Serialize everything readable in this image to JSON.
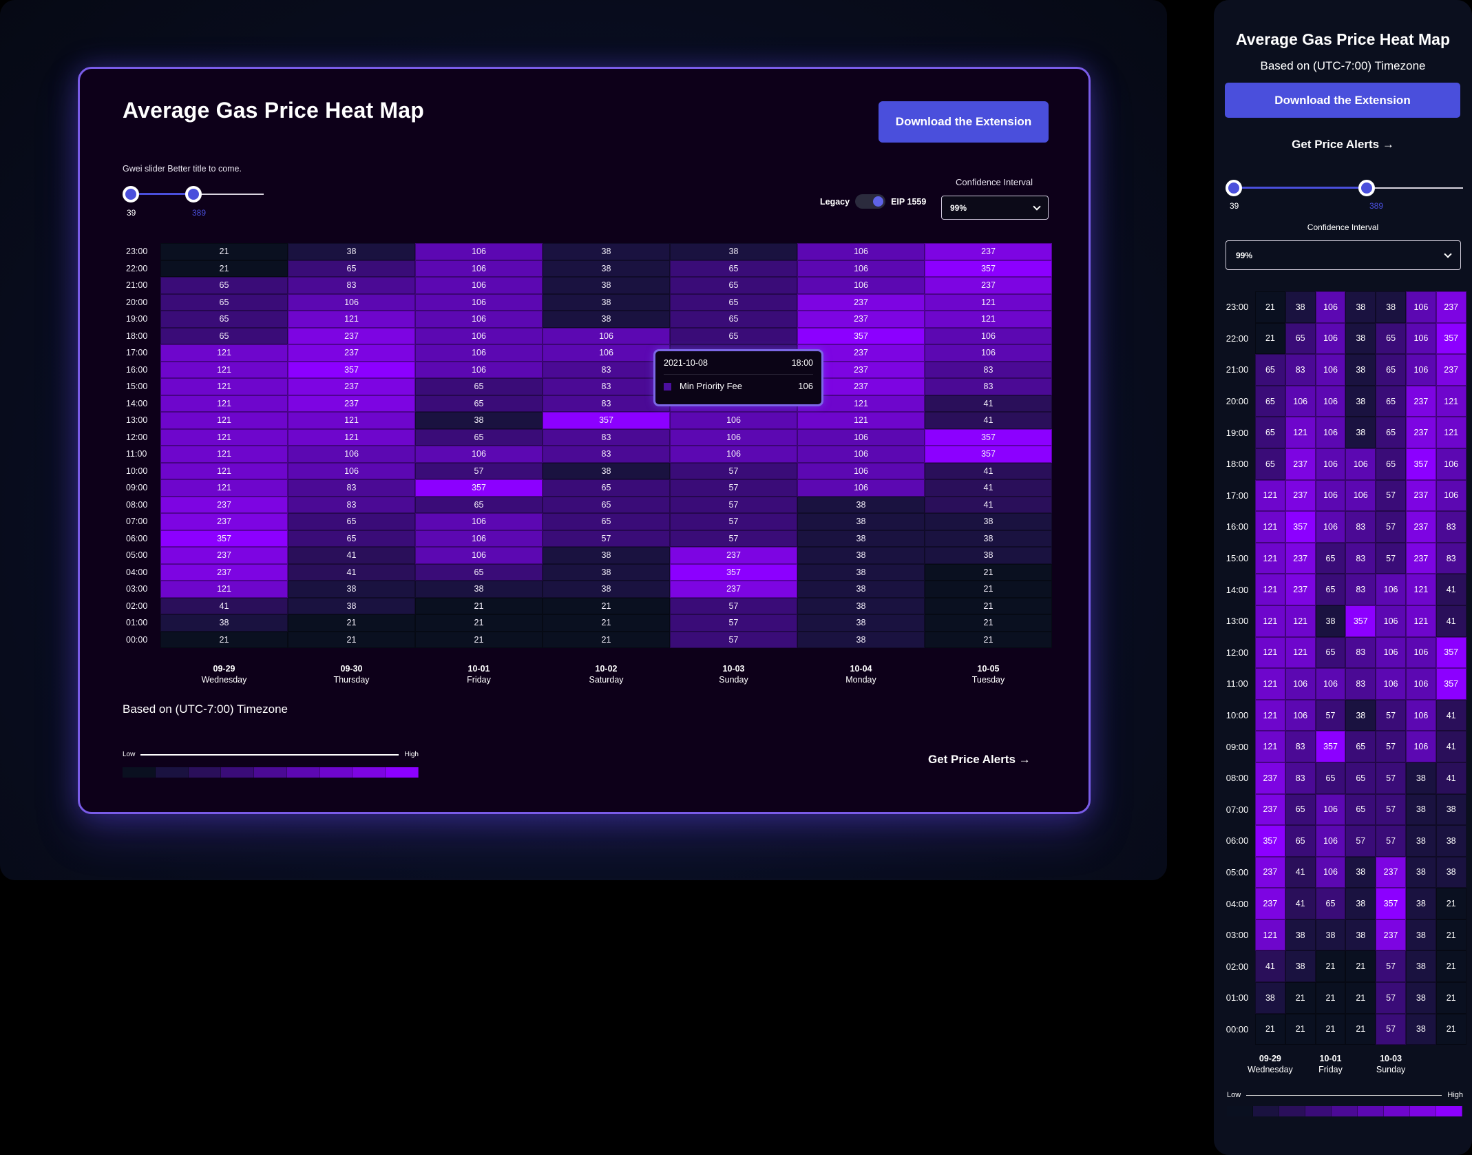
{
  "desktop": {
    "title": "Average Gas Price Heat Map",
    "download_button": "Download the Extension",
    "slider": {
      "label": "Gwei slider Better title to come.",
      "min_value": "39",
      "max_value": "389",
      "low_fraction": 0.0,
      "high_fraction": 0.5
    },
    "toggle": {
      "left_label": "Legacy",
      "right_label": "EIP 1559",
      "state": "EIP 1559"
    },
    "confidence": {
      "label": "Confidence Interval",
      "selected": "99%"
    },
    "timezone_note": "Based on (UTC-7:00) Timezone",
    "legend": {
      "low": "Low",
      "high": "High"
    },
    "alerts_link": "Get Price Alerts",
    "arrow_icon": "→",
    "tooltip": {
      "date": "2021-10-08",
      "time": "18:00",
      "series": "Min Priority Fee",
      "value": "106"
    }
  },
  "mobile": {
    "title": "Average Gas Price Heat Map",
    "timezone_note": "Based on (UTC-7:00) Timezone",
    "download_button": "Download the Extension",
    "alerts_link": "Get Price Alerts",
    "slider": {
      "min_value": "39",
      "max_value": "389",
      "low_fraction": 0.0,
      "high_fraction": 0.6
    },
    "confidence": {
      "label": "Confidence Interval",
      "selected": "99%"
    },
    "x_labels": [
      {
        "date": "09-29",
        "day": "Wednesday",
        "col": 0
      },
      {
        "date": "10-01",
        "day": "Friday",
        "col": 2
      },
      {
        "date": "10-03",
        "day": "Sunday",
        "col": 4
      }
    ],
    "legend": {
      "low": "Low",
      "high": "High"
    }
  },
  "color_scale": [
    "#0a1020",
    "#1a1240",
    "#2a0f5a",
    "#3a0c78",
    "#4b0a95",
    "#5c08b2",
    "#6e06cc",
    "#7d05e2",
    "#8c00ff"
  ],
  "chart_data": {
    "type": "heatmap",
    "title": "Average Gas Price Heat Map",
    "xlabel": "",
    "ylabel": "",
    "columns": [
      {
        "date": "09-29",
        "day": "Wednesday"
      },
      {
        "date": "09-30",
        "day": "Thursday"
      },
      {
        "date": "10-01",
        "day": "Friday"
      },
      {
        "date": "10-02",
        "day": "Saturday"
      },
      {
        "date": "10-03",
        "day": "Sunday"
      },
      {
        "date": "10-04",
        "day": "Monday"
      },
      {
        "date": "10-05",
        "day": "Tuesday"
      }
    ],
    "hours": [
      "23:00",
      "22:00",
      "21:00",
      "20:00",
      "19:00",
      "18:00",
      "17:00",
      "16:00",
      "15:00",
      "14:00",
      "13:00",
      "12:00",
      "11:00",
      "10:00",
      "09:00",
      "08:00",
      "07:00",
      "06:00",
      "05:00",
      "04:00",
      "03:00",
      "02:00",
      "01:00",
      "00:00"
    ],
    "values": [
      [
        21,
        38,
        106,
        38,
        38,
        106,
        237
      ],
      [
        21,
        65,
        106,
        38,
        65,
        106,
        357
      ],
      [
        65,
        83,
        106,
        38,
        65,
        106,
        237
      ],
      [
        65,
        106,
        106,
        38,
        65,
        237,
        121
      ],
      [
        65,
        121,
        106,
        38,
        65,
        237,
        121
      ],
      [
        65,
        237,
        106,
        106,
        65,
        357,
        106
      ],
      [
        121,
        237,
        106,
        106,
        57,
        237,
        106
      ],
      [
        121,
        357,
        106,
        83,
        57,
        237,
        83
      ],
      [
        121,
        237,
        65,
        83,
        57,
        237,
        83
      ],
      [
        121,
        237,
        65,
        83,
        106,
        121,
        41
      ],
      [
        121,
        121,
        38,
        357,
        106,
        121,
        41
      ],
      [
        121,
        121,
        65,
        83,
        106,
        106,
        357
      ],
      [
        121,
        106,
        106,
        83,
        106,
        106,
        357
      ],
      [
        121,
        106,
        57,
        38,
        57,
        106,
        41
      ],
      [
        121,
        83,
        357,
        65,
        57,
        106,
        41
      ],
      [
        237,
        83,
        65,
        65,
        57,
        38,
        41
      ],
      [
        237,
        65,
        106,
        65,
        57,
        38,
        38
      ],
      [
        357,
        65,
        106,
        57,
        57,
        38,
        38
      ],
      [
        237,
        41,
        106,
        38,
        237,
        38,
        38
      ],
      [
        237,
        41,
        65,
        38,
        357,
        38,
        21
      ],
      [
        121,
        38,
        38,
        38,
        237,
        38,
        21
      ],
      [
        41,
        38,
        21,
        21,
        57,
        38,
        21
      ],
      [
        38,
        21,
        21,
        21,
        57,
        38,
        21
      ],
      [
        21,
        21,
        21,
        21,
        57,
        38,
        21
      ]
    ],
    "value_levels": [
      21,
      38,
      41,
      57,
      65,
      83,
      106,
      121,
      237,
      357
    ],
    "legend": {
      "low": "Low",
      "high": "High",
      "placement": "bottom-left"
    }
  }
}
